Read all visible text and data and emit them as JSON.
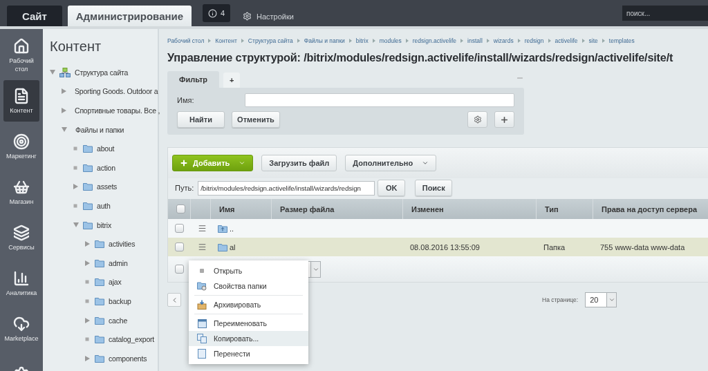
{
  "topbar": {
    "tabs": [
      {
        "label": "Сайт",
        "selected": false
      },
      {
        "label": "Администрирование",
        "selected": true
      }
    ],
    "notifications": "4",
    "settings": "Настройки",
    "search": {
      "placeholder": "поиск..."
    }
  },
  "rail": [
    {
      "label": "Рабочий стол",
      "selected": false
    },
    {
      "label": "Контент",
      "selected": true
    },
    {
      "label": "Маркетинг",
      "selected": false
    },
    {
      "label": "Магазин",
      "selected": false
    },
    {
      "label": "Сервисы",
      "selected": false
    },
    {
      "label": "Аналитика",
      "selected": false
    },
    {
      "label": "Marketplace",
      "selected": false
    },
    {
      "selected": false
    }
  ],
  "tree": {
    "title": "Контент",
    "items": [
      {
        "label": "Структура сайта",
        "kind": "site",
        "expandable": true,
        "expanded": true,
        "children": [
          {
            "label": "Sporting Goods. Outdoor a",
            "kind": "section",
            "expandable": true,
            "expanded": false
          },
          {
            "label": "Спортивные товары. Все ,",
            "kind": "section",
            "expandable": true,
            "expanded": false
          },
          {
            "label": "Файлы и папки",
            "kind": "section",
            "expandable": true,
            "expanded": true,
            "children": [
              {
                "label": "about",
                "kind": "folder",
                "expandable": false
              },
              {
                "label": "action",
                "kind": "folder",
                "expandable": false
              },
              {
                "label": "assets",
                "kind": "folder",
                "expandable": true,
                "expanded": false
              },
              {
                "label": "auth",
                "kind": "folder",
                "expandable": false
              },
              {
                "label": "bitrix",
                "kind": "folder",
                "expandable": true,
                "expanded": true,
                "children": [
                  {
                    "label": "activities",
                    "kind": "folder",
                    "expandable": true,
                    "expanded": false
                  },
                  {
                    "label": "admin",
                    "kind": "folder",
                    "expandable": true,
                    "expanded": false
                  },
                  {
                    "label": "ajax",
                    "kind": "folder",
                    "expandable": false
                  },
                  {
                    "label": "backup",
                    "kind": "folder",
                    "expandable": false
                  },
                  {
                    "label": "cache",
                    "kind": "folder",
                    "expandable": true,
                    "expanded": false
                  },
                  {
                    "label": "catalog_export",
                    "kind": "folder",
                    "expandable": false
                  },
                  {
                    "label": "components",
                    "kind": "folder",
                    "expandable": true,
                    "expanded": false
                  }
                ]
              }
            ]
          }
        ]
      }
    ]
  },
  "breadcrumbs": [
    "Рабочий стол",
    "Контент",
    "Структура сайта",
    "Файлы и папки",
    "bitrix",
    "modules",
    "redsign.activelife",
    "install",
    "wizards",
    "redsign",
    "activelife",
    "site",
    "templates"
  ],
  "title": "Управление структурой: /bitrix/modules/redsign.activelife/install/wizards/redsign/activelife/site/t",
  "filter": {
    "tabs": [
      {
        "label": "Фильтр",
        "selected": true
      },
      {
        "label": "+",
        "selected": false
      }
    ],
    "field_label": "Имя:",
    "buttons": [
      "Найти",
      "Отменить"
    ]
  },
  "toolbar": [
    {
      "label": "Добавить",
      "kind": "primary",
      "dropdown": true
    },
    {
      "label": "Загрузить файл",
      "kind": "default",
      "dropdown": false
    },
    {
      "label": "Дополнительно",
      "kind": "default",
      "dropdown": true
    }
  ],
  "path": {
    "label": "Путь:",
    "value": "/bitrix/modules/redsign.activelife/install/wizards/redsign",
    "buttons": [
      "OK",
      "Поиск"
    ]
  },
  "table": {
    "all_checked": false,
    "columns": [
      "Имя",
      "Размер файла",
      "Изменен",
      "Тип",
      "Права на доступ сервера"
    ],
    "rows": [
      {
        "kind": "parent",
        "name": "..",
        "checked": false,
        "selected": false
      },
      {
        "kind": "folder",
        "name": "al",
        "modified": "08.08.2016 13:55:09",
        "type": "Папка",
        "rights": "755 www-data www-data",
        "checked": false,
        "selected": true
      }
    ],
    "footer_checked": false
  },
  "pagination": {
    "per_page_label": "На странице:",
    "per_page": "20"
  },
  "context_menu": {
    "groups": [
      {
        "items": [
          {
            "kind": "open",
            "label": "Открыть",
            "selected": false
          },
          {
            "kind": "properties",
            "label": "Свойства папки",
            "selected": false
          }
        ]
      },
      {
        "items": [
          {
            "kind": "archive",
            "label": "Архивировать",
            "selected": false
          }
        ]
      },
      {
        "items": [
          {
            "kind": "rename",
            "label": "Переименовать",
            "selected": false
          },
          {
            "kind": "copy",
            "label": "Копировать...",
            "selected": true
          },
          {
            "kind": "move",
            "label": "Перенести",
            "selected": false
          }
        ]
      }
    ]
  }
}
